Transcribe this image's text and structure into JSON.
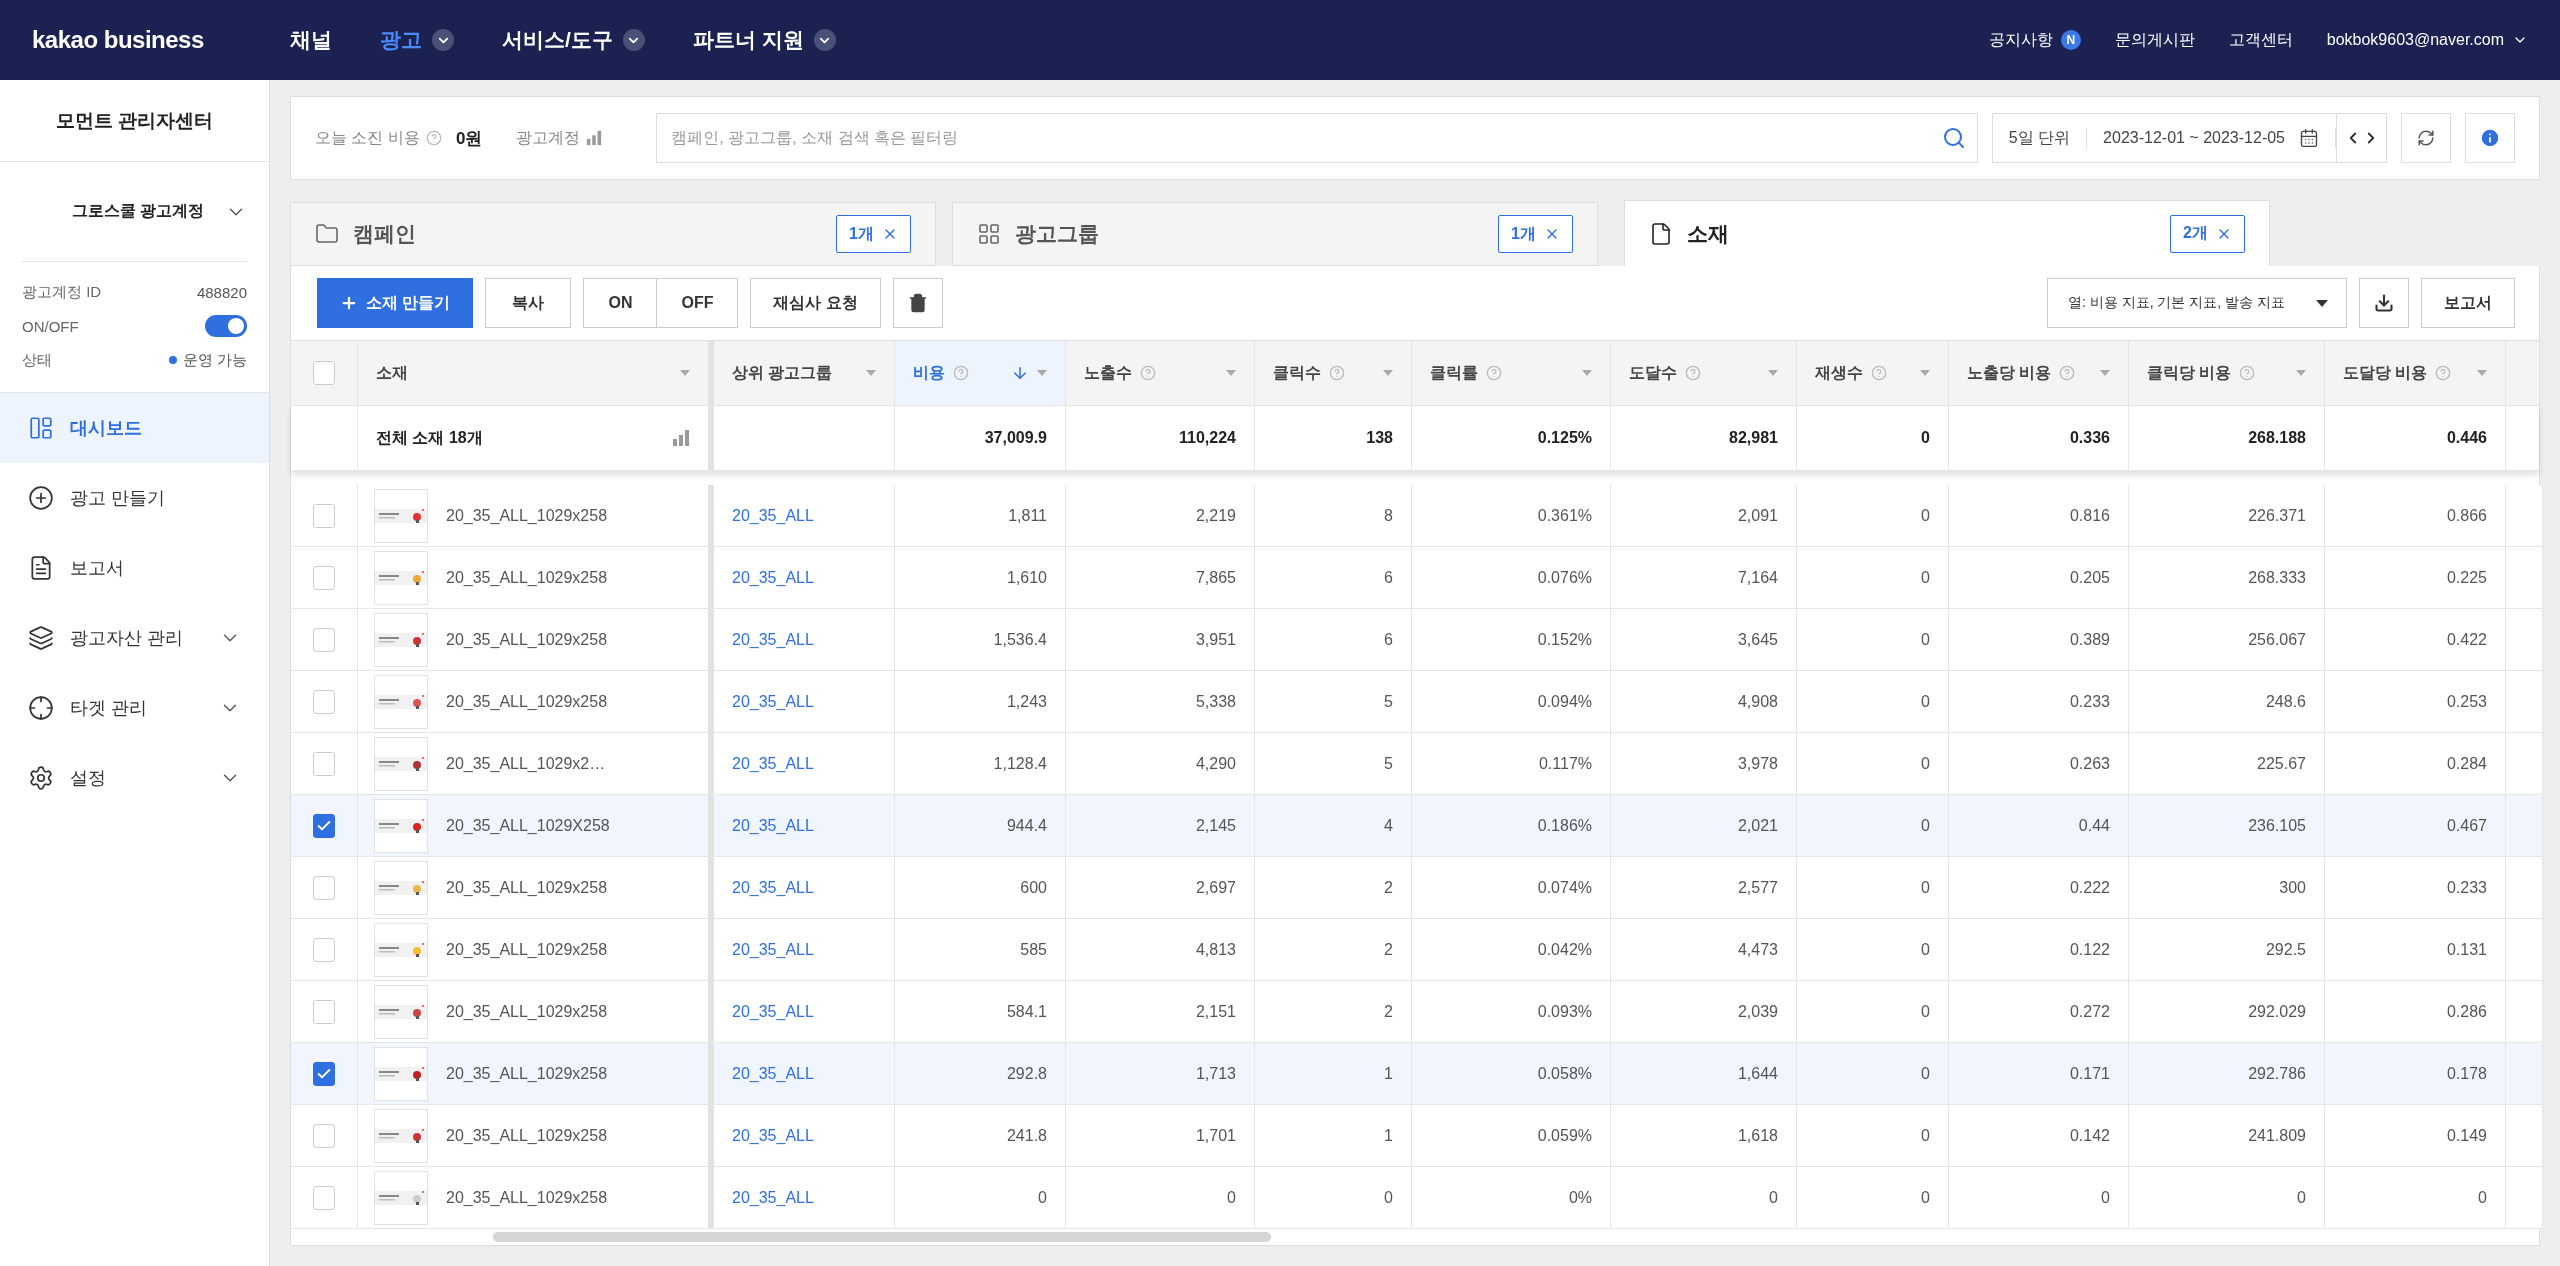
{
  "top_nav": {
    "logo": "kakao business",
    "menus": [
      {
        "label": "채널",
        "selected": false,
        "dropdown": false
      },
      {
        "label": "광고",
        "selected": true,
        "dropdown": true
      },
      {
        "label": "서비스/도구",
        "selected": false,
        "dropdown": true
      },
      {
        "label": "파트너 지원",
        "selected": false,
        "dropdown": true
      }
    ],
    "links": [
      {
        "label": "공지사항",
        "badge": "N"
      },
      {
        "label": "문의게시판"
      },
      {
        "label": "고객센터"
      }
    ],
    "user": "bokbok9603@naver.com"
  },
  "sidebar": {
    "title": "모먼트 관리자센터",
    "account": "그로스쿨 광고계정",
    "info": [
      {
        "kind": "text",
        "label": "광고계정 ID",
        "value": "488820"
      },
      {
        "kind": "toggle",
        "label": "ON/OFF",
        "on": true
      },
      {
        "kind": "status",
        "label": "상태",
        "value": "운영 가능"
      }
    ],
    "items": [
      {
        "label": "대시보드",
        "selected": true,
        "expandable": false
      },
      {
        "label": "광고 만들기",
        "selected": false,
        "expandable": false
      },
      {
        "label": "보고서",
        "selected": false,
        "expandable": false
      },
      {
        "label": "광고자산 관리",
        "selected": false,
        "expandable": true
      },
      {
        "label": "타겟 관리",
        "selected": false,
        "expandable": true
      },
      {
        "label": "설정",
        "selected": false,
        "expandable": true
      }
    ]
  },
  "filter_bar": {
    "spend_label": "오늘 소진 비용",
    "spend_value": "0원",
    "account_label": "광고계정",
    "search_placeholder": "캠페인, 광고그룹, 소재 검색 혹은 필터링",
    "period": "5일 단위",
    "date_range": "2023-12-01 ~ 2023-12-05"
  },
  "tabs": [
    {
      "label": "캠페인",
      "count": "1개",
      "selected": false
    },
    {
      "label": "광고그룹",
      "count": "1개",
      "selected": false
    },
    {
      "label": "소재",
      "count": "2개",
      "selected": true
    }
  ],
  "toolbar": {
    "create": "소재 만들기",
    "copy": "복사",
    "on": "ON",
    "off": "OFF",
    "review": "재심사 요청",
    "columns": "열: 비용 지표, 기본 지표, 발송 지표",
    "report": "보고서"
  },
  "table": {
    "all_checked": false,
    "columns": [
      {
        "label": "소재",
        "help": false,
        "sorted": false
      },
      {
        "label": "상위 광고그룹",
        "help": false,
        "sorted": false
      },
      {
        "label": "비용",
        "help": true,
        "sorted": true
      },
      {
        "label": "노출수",
        "help": true,
        "sorted": false
      },
      {
        "label": "클릭수",
        "help": true,
        "sorted": false
      },
      {
        "label": "클릭률",
        "help": true,
        "sorted": false
      },
      {
        "label": "도달수",
        "help": true,
        "sorted": false
      },
      {
        "label": "재생수",
        "help": true,
        "sorted": false
      },
      {
        "label": "노출당 비용",
        "help": true,
        "sorted": false
      },
      {
        "label": "클릭당 비용",
        "help": true,
        "sorted": false
      },
      {
        "label": "도달당 비용",
        "help": true,
        "sorted": false
      }
    ],
    "summary": {
      "label": "전체 소재 18개",
      "values": [
        "37,009.9",
        "110,224",
        "138",
        "0.125%",
        "82,981",
        "0",
        "0.336",
        "268.188",
        "0.446"
      ]
    },
    "rows": [
      {
        "checked": false,
        "name": "20_35_ALL_1029x258",
        "group": "20_35_ALL",
        "values": [
          "1,811",
          "2,219",
          "8",
          "0.361%",
          "2,091",
          "0",
          "0.816",
          "226.371",
          "0.866"
        ]
      },
      {
        "checked": false,
        "name": "20_35_ALL_1029x258",
        "group": "20_35_ALL",
        "values": [
          "1,610",
          "7,865",
          "6",
          "0.076%",
          "7,164",
          "0",
          "0.205",
          "268.333",
          "0.225"
        ]
      },
      {
        "checked": false,
        "name": "20_35_ALL_1029x258",
        "group": "20_35_ALL",
        "values": [
          "1,536.4",
          "3,951",
          "6",
          "0.152%",
          "3,645",
          "0",
          "0.389",
          "256.067",
          "0.422"
        ]
      },
      {
        "checked": false,
        "name": "20_35_ALL_1029x258",
        "group": "20_35_ALL",
        "values": [
          "1,243",
          "5,338",
          "5",
          "0.094%",
          "4,908",
          "0",
          "0.233",
          "248.6",
          "0.253"
        ]
      },
      {
        "checked": false,
        "name": "20_35_ALL_1029x2…",
        "group": "20_35_ALL",
        "values": [
          "1,128.4",
          "4,290",
          "5",
          "0.117%",
          "3,978",
          "0",
          "0.263",
          "225.67",
          "0.284"
        ]
      },
      {
        "checked": true,
        "name": "20_35_ALL_1029X258",
        "group": "20_35_ALL",
        "values": [
          "944.4",
          "2,145",
          "4",
          "0.186%",
          "2,021",
          "0",
          "0.44",
          "236.105",
          "0.467"
        ]
      },
      {
        "checked": false,
        "name": "20_35_ALL_1029x258",
        "group": "20_35_ALL",
        "values": [
          "600",
          "2,697",
          "2",
          "0.074%",
          "2,577",
          "0",
          "0.222",
          "300",
          "0.233"
        ]
      },
      {
        "checked": false,
        "name": "20_35_ALL_1029x258",
        "group": "20_35_ALL",
        "values": [
          "585",
          "4,813",
          "2",
          "0.042%",
          "4,473",
          "0",
          "0.122",
          "292.5",
          "0.131"
        ]
      },
      {
        "checked": false,
        "name": "20_35_ALL_1029x258",
        "group": "20_35_ALL",
        "values": [
          "584.1",
          "2,151",
          "2",
          "0.093%",
          "2,039",
          "0",
          "0.272",
          "292.029",
          "0.286"
        ]
      },
      {
        "checked": true,
        "name": "20_35_ALL_1029x258",
        "group": "20_35_ALL",
        "values": [
          "292.8",
          "1,713",
          "1",
          "0.058%",
          "1,644",
          "0",
          "0.171",
          "292.786",
          "0.178"
        ]
      },
      {
        "checked": false,
        "name": "20_35_ALL_1029x258",
        "group": "20_35_ALL",
        "values": [
          "241.8",
          "1,701",
          "1",
          "0.059%",
          "1,618",
          "0",
          "0.142",
          "241.809",
          "0.149"
        ]
      },
      {
        "checked": false,
        "name": "20_35_ALL_1029x258",
        "group": "20_35_ALL",
        "values": [
          "0",
          "0",
          "0",
          "0%",
          "0",
          "0",
          "0",
          "0",
          "0"
        ]
      }
    ]
  }
}
